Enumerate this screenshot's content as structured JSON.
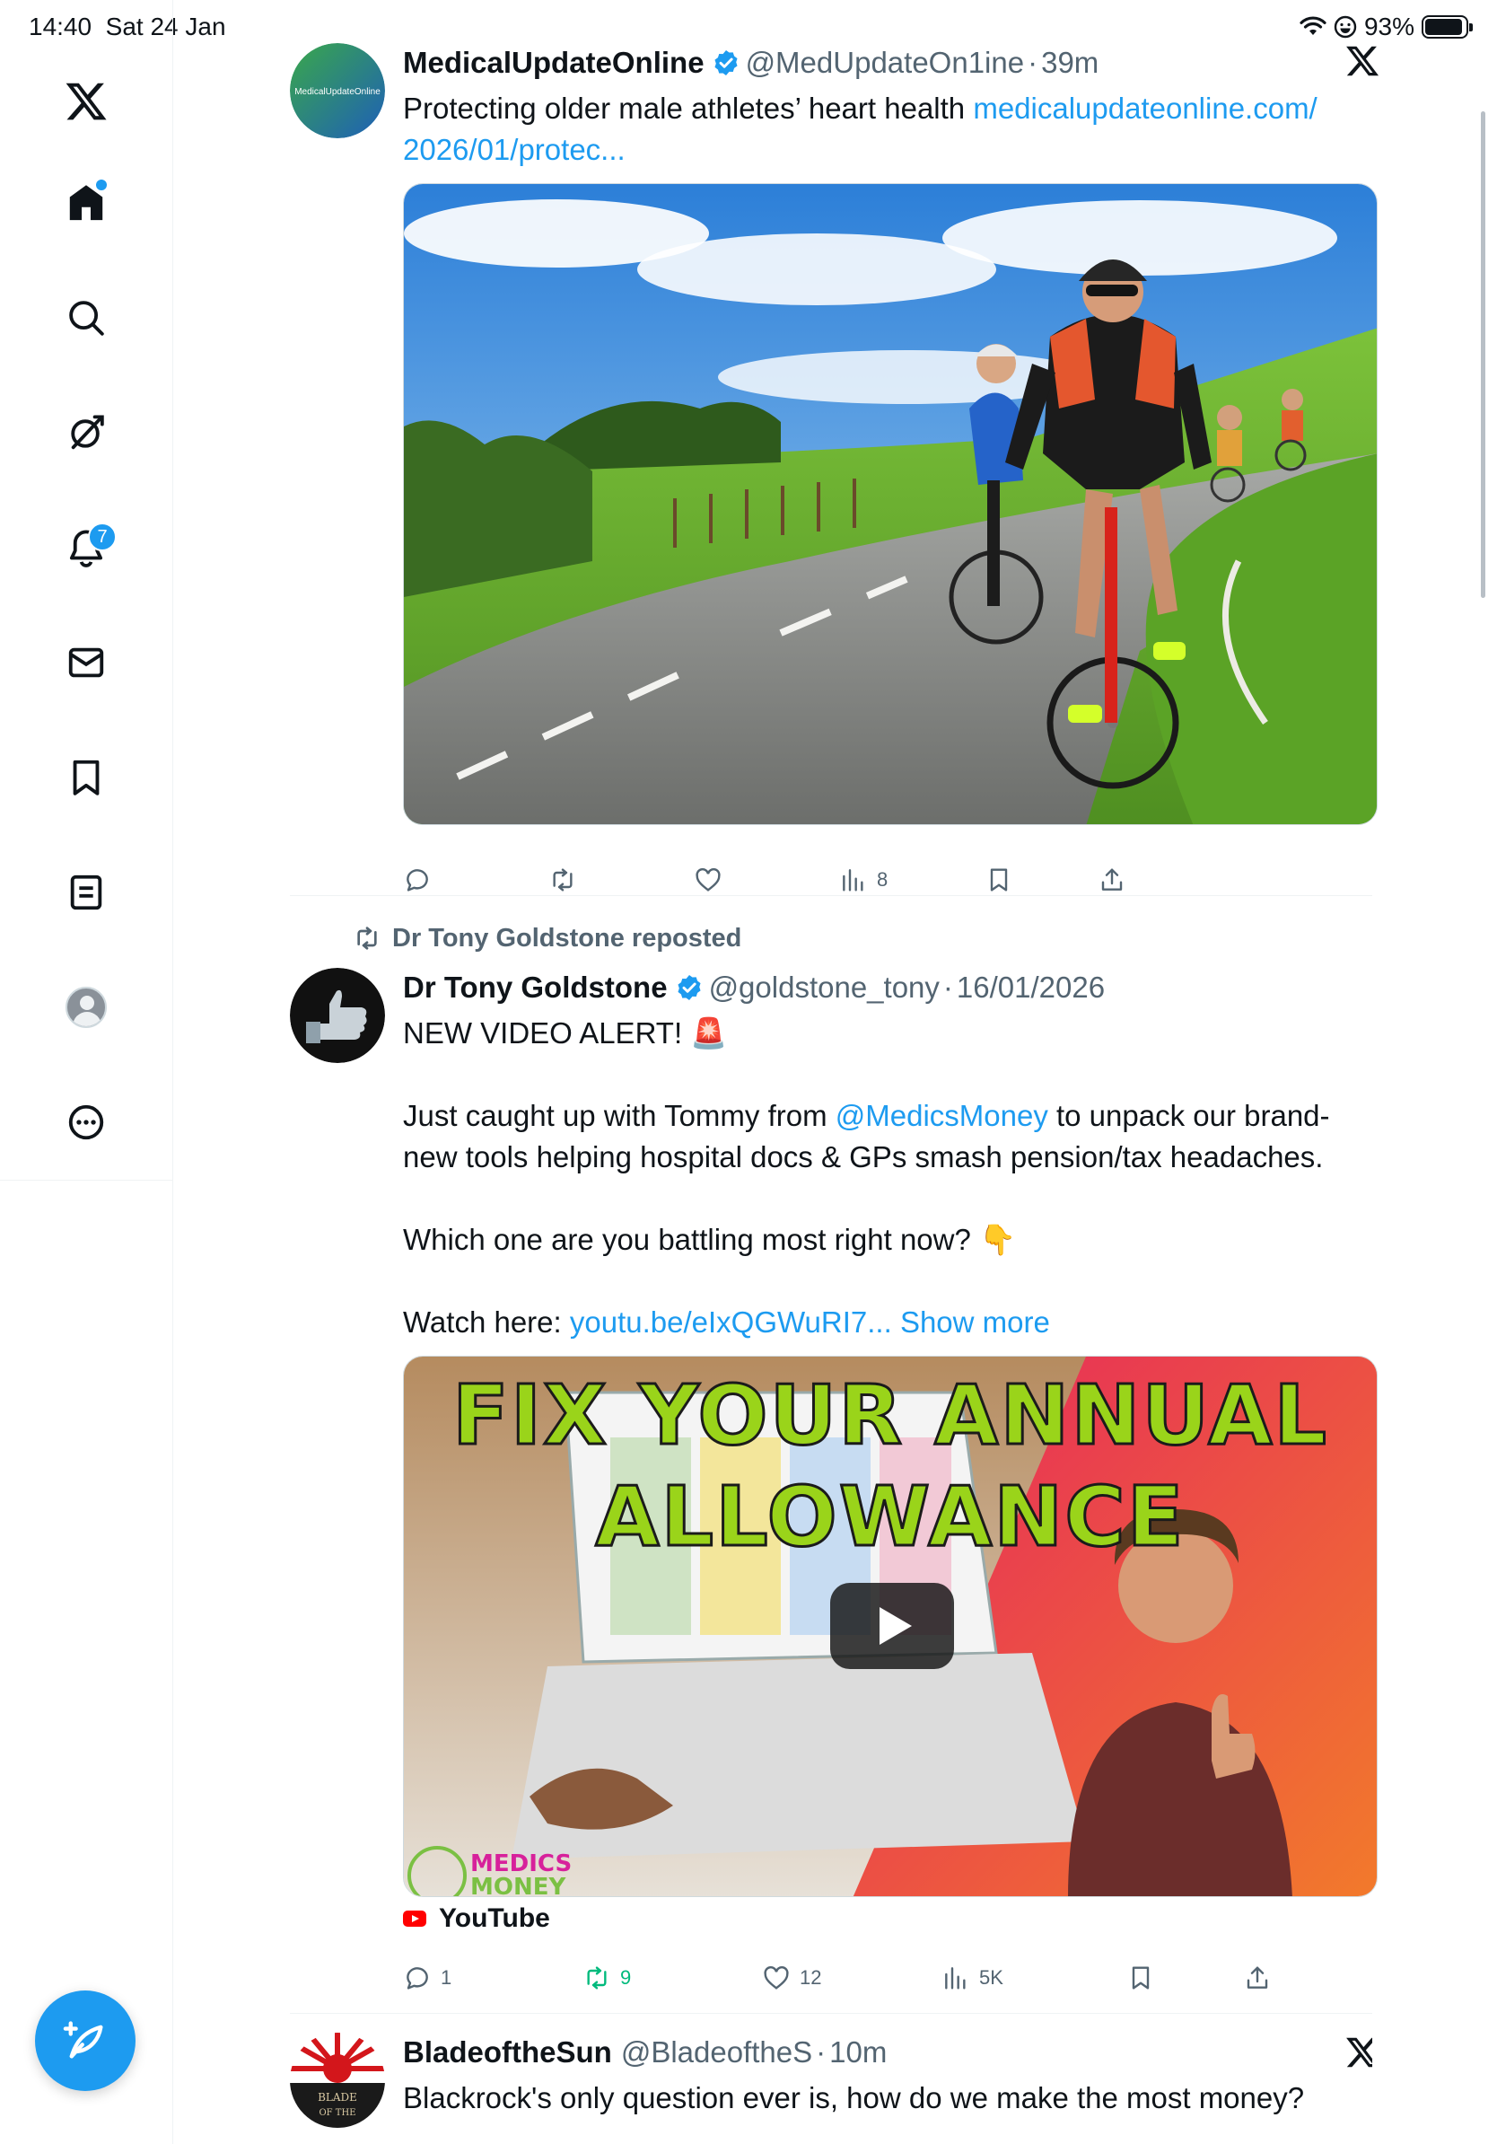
{
  "status_bar": {
    "time": "14:40",
    "date": "Sat 24 Jan",
    "battery": "93%",
    "battery_level": 0.93
  },
  "sidebar": {
    "notifications_badge": "7",
    "items": [
      {
        "name": "home",
        "icon": "home-icon"
      },
      {
        "name": "explore",
        "icon": "search-icon"
      },
      {
        "name": "grok",
        "icon": "grok-icon"
      },
      {
        "name": "notifications",
        "icon": "bell-icon"
      },
      {
        "name": "messages",
        "icon": "envelope-icon"
      },
      {
        "name": "bookmarks",
        "icon": "bookmark-icon"
      },
      {
        "name": "lists",
        "icon": "list-icon"
      },
      {
        "name": "profile",
        "icon": "avatar"
      },
      {
        "name": "more",
        "icon": "more-icon"
      }
    ]
  },
  "tweets": [
    {
      "display_name": "MedicalUpdateOnline",
      "handle": "@MedUpdateOn1ine",
      "time": "39m",
      "avatar_text": "MedicalUpdateOnline",
      "text": "Protecting older male athletes’ heart health ",
      "link_line1": "medicalupdateonline.com/",
      "link_line2": "2026/01/protec...",
      "stats": {
        "views": "8"
      }
    },
    {
      "reposted_by": "Dr Tony Goldstone reposted",
      "display_name": "Dr Tony Goldstone",
      "handle": "@goldstone_tony",
      "time": "16/01/2026",
      "line1": "NEW VIDEO ALERT! 🚨",
      "line2a": "Just caught up with Tommy from ",
      "mention": "@MedicsMoney",
      "line2b": " to unpack our brand-new tools helping hospital docs & GPs smash pension/tax headaches.",
      "line3": "Which one are you battling most right now? 👇",
      "watch_prefix": "Watch here: ",
      "watch_link": "youtu.be/eIxQGWuRI7...",
      "show_more": "Show more",
      "video": {
        "title_line1": "FIX YOUR ANNUAL",
        "title_line2": "ALLOWANCE",
        "logo_line1": "MEDICS",
        "logo_line2": "MONEY"
      },
      "source": "YouTube",
      "stats": {
        "replies": "1",
        "reposts": "9",
        "likes": "12",
        "views": "5K"
      }
    },
    {
      "display_name": "BladeoftheSun",
      "handle": "@BladeoftheS",
      "time": "10m",
      "text": "Blackrock's only question ever is, how do we make the most money?",
      "avatar_text_1": "BLADE",
      "avatar_text_2": "OF THE"
    }
  ],
  "colors": {
    "accent": "#1d9bf0",
    "retweet_green": "#00ba7c",
    "secondary_text": "#536471",
    "divider": "#eff3f4"
  }
}
